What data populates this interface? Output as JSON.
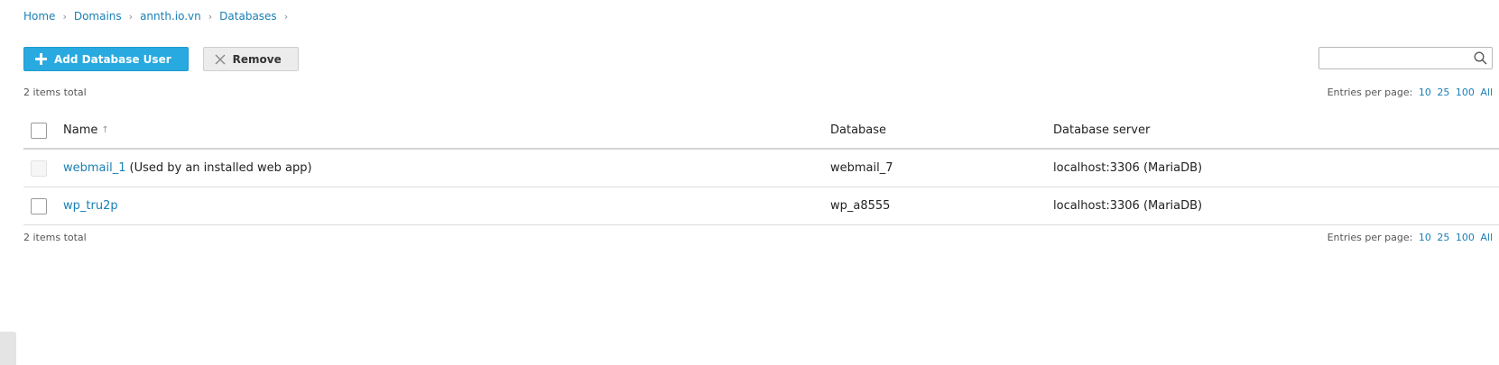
{
  "breadcrumb": [
    {
      "label": "Home"
    },
    {
      "label": "Domains"
    },
    {
      "label": "annth.io.vn"
    },
    {
      "label": "Databases"
    }
  ],
  "toolbar": {
    "add_label": "Add Database User",
    "remove_label": "Remove"
  },
  "search": {
    "placeholder": "",
    "value": ""
  },
  "summary": {
    "total": "2 items total",
    "entries_label": "Entries per page:",
    "page_sizes": [
      "10",
      "25",
      "100",
      "All"
    ]
  },
  "table": {
    "columns": {
      "name": "Name",
      "database": "Database",
      "server": "Database server"
    },
    "rows": [
      {
        "name": "webmail_1",
        "note": "(Used by an installed web app)",
        "database": "webmail_7",
        "server": "localhost:3306 (MariaDB)",
        "checkbox_disabled": true
      },
      {
        "name": "wp_tru2p",
        "note": "",
        "database": "wp_a8555",
        "server": "localhost:3306 (MariaDB)",
        "checkbox_disabled": false
      }
    ]
  },
  "colors": {
    "accent": "#28a9e0",
    "link": "#1a7fb5"
  }
}
